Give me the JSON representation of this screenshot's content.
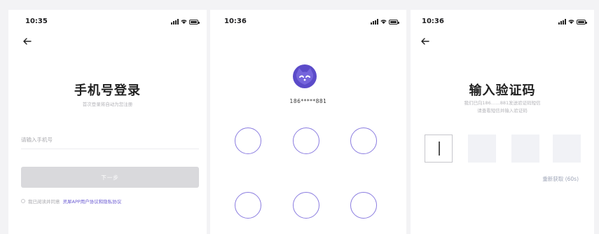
{
  "screen_login": {
    "status_time": "10:35",
    "title": "手机号登录",
    "subtitle": "首次登录将自动为您注册",
    "phone_placeholder": "请输入手机号",
    "next_label": "下一步",
    "agreement_prefix": "我已阅读并同意",
    "agreement_link": "灵犀APP用户协议和隐私协议"
  },
  "screen_pattern": {
    "status_time": "10:36",
    "masked_phone": "186*****881",
    "pattern_dot_count": 6
  },
  "screen_code": {
    "status_time": "10:36",
    "title": "输入验证码",
    "subtitle_line1": "我们已向186……881发送验证码短信",
    "subtitle_line2": "请查看短信并输入验证码",
    "resend_label": "重新获取 (60s)",
    "code_length": 4
  },
  "colors": {
    "accent": "#6a5ad2",
    "pattern_ring": "#8b7de0",
    "button_disabled": "#d9d9dc",
    "code_box": "#f1f2f6"
  },
  "icons": {
    "back": "arrow-left-icon",
    "signal": "signal-icon",
    "wifi": "wifi-icon",
    "battery": "battery-icon",
    "avatar": "cat-avatar-icon"
  }
}
